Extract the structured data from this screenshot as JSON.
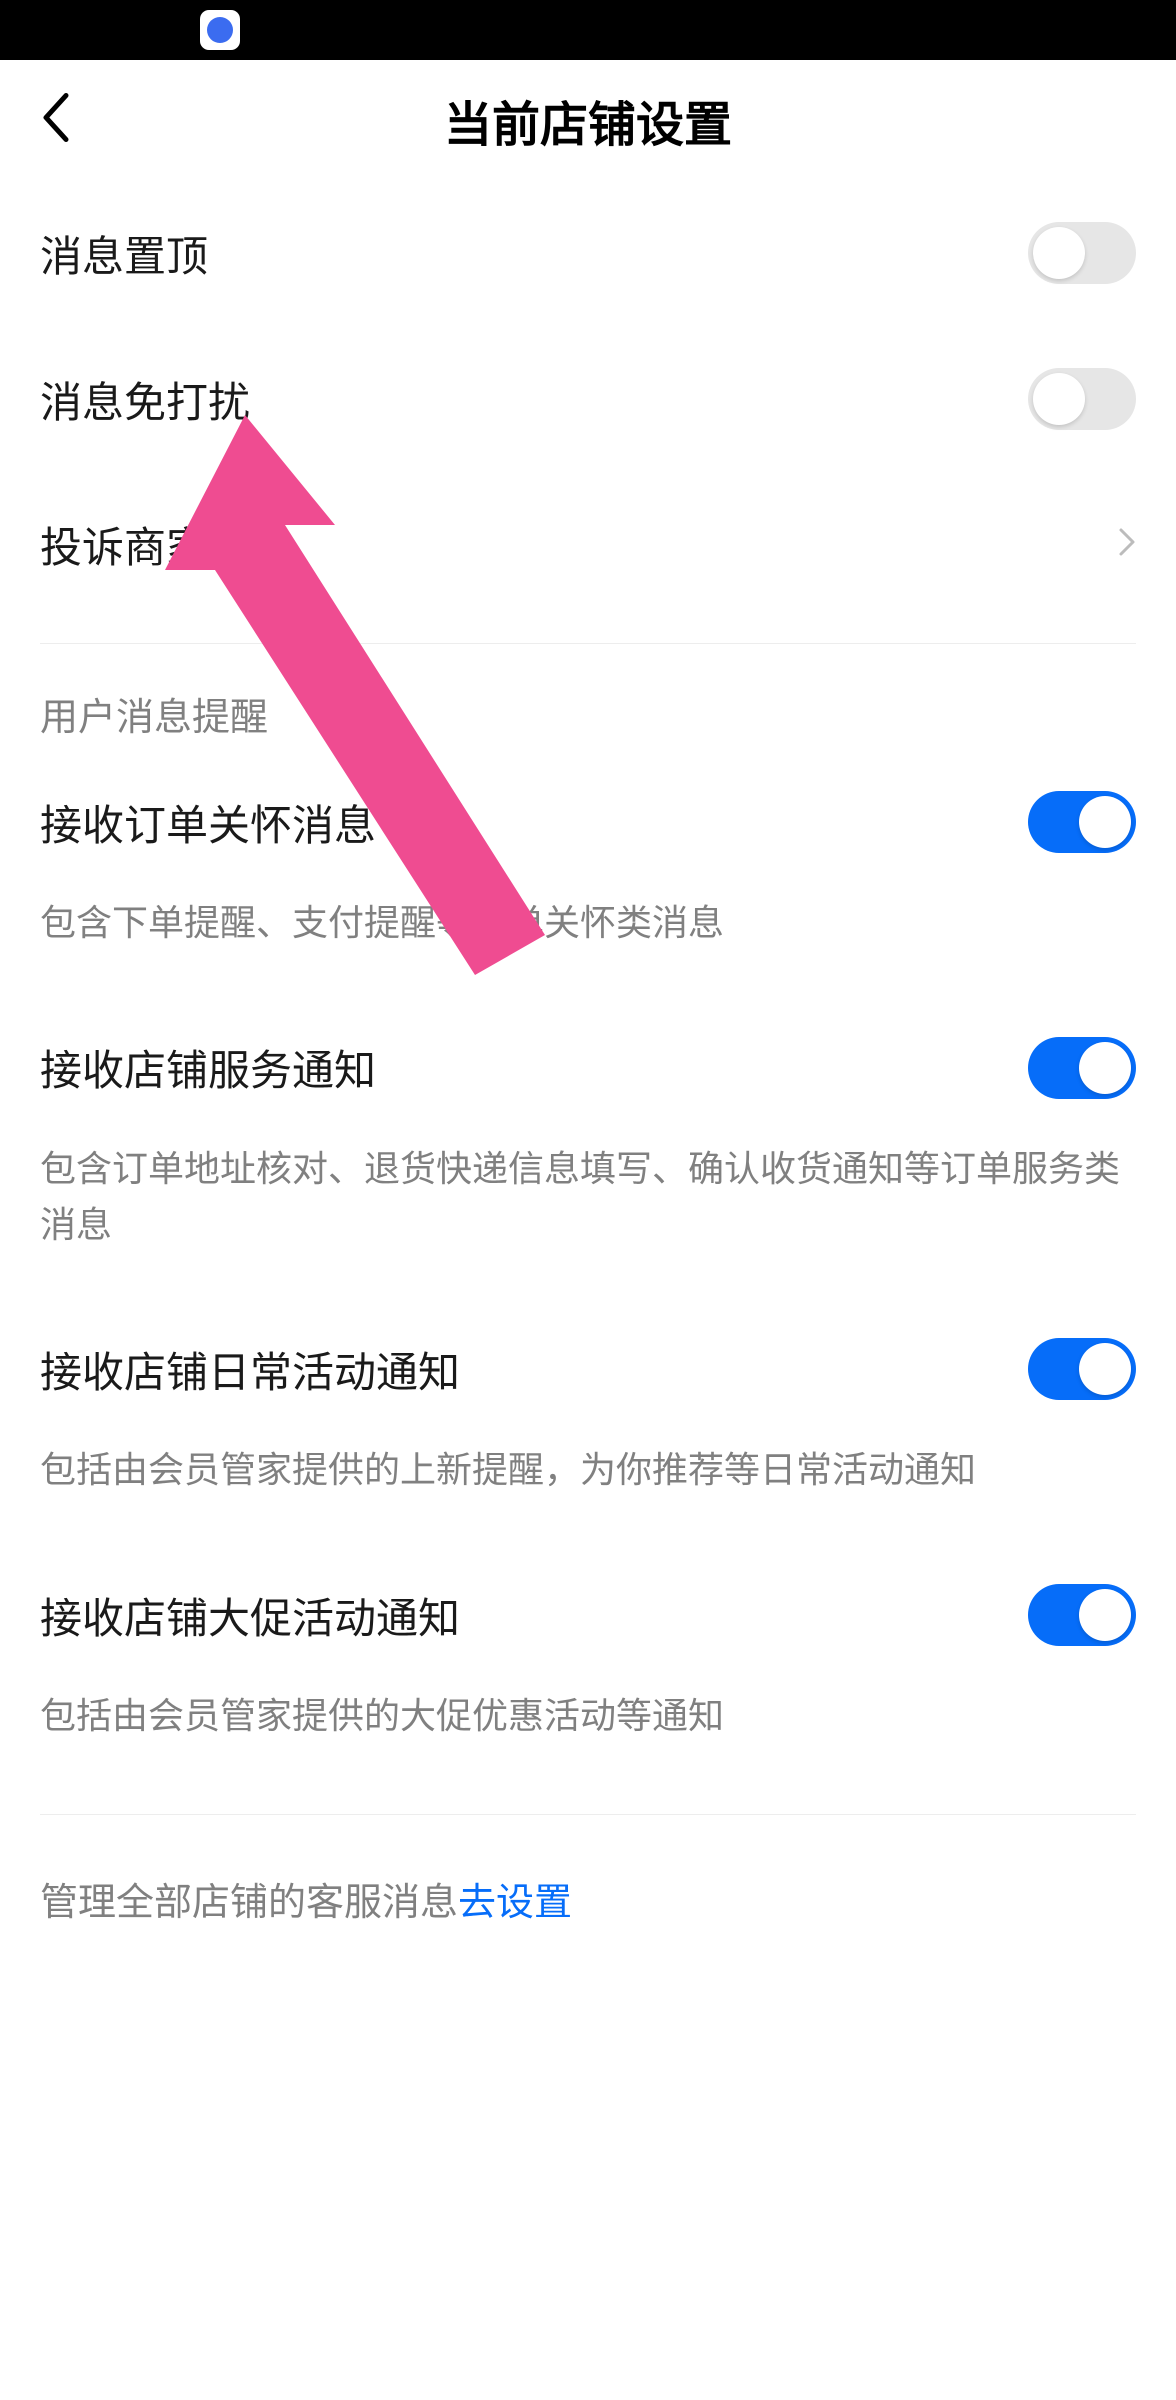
{
  "header": {
    "title": "当前店铺设置"
  },
  "rows": {
    "pin": {
      "label": "消息置顶",
      "on": false
    },
    "dnd": {
      "label": "消息免打扰",
      "on": false
    },
    "complain": {
      "label": "投诉商家"
    }
  },
  "section1": {
    "title": "用户消息提醒"
  },
  "order_care": {
    "label": "接收订单关怀消息",
    "desc": "包含下单提醒、支付提醒等订单关怀类消息",
    "on": true
  },
  "shop_service": {
    "label": "接收店铺服务通知",
    "desc": "包含订单地址核对、退货快递信息填写、确认收货通知等订单服务类消息",
    "on": true
  },
  "daily_activity": {
    "label": "接收店铺日常活动通知",
    "desc": "包括由会员管家提供的上新提醒，为你推荐等日常活动通知",
    "on": true
  },
  "promo_activity": {
    "label": "接收店铺大促活动通知",
    "desc": "包括由会员管家提供的大促优惠活动等通知",
    "on": true
  },
  "footer": {
    "text": "管理全部店铺的客服消息",
    "link": "去设置"
  },
  "colors": {
    "accent": "#066df9",
    "overlay_arrow": "#ef4c91"
  }
}
